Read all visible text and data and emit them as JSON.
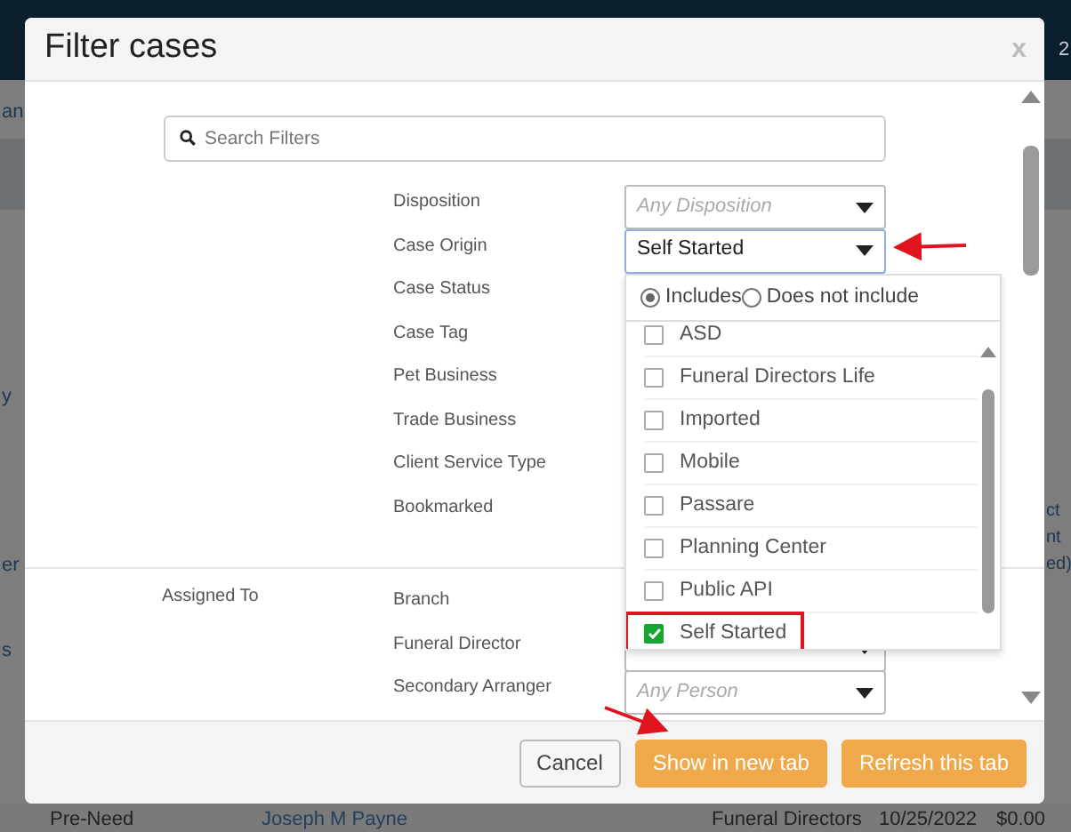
{
  "background": {
    "top_fragment": "2",
    "left_fragments": [
      "an",
      "y",
      "er",
      "s"
    ],
    "right_fragments": [
      "ct",
      "nt",
      "ed)"
    ],
    "bottom_row": [
      "Pre-Need",
      "Joseph M Payne",
      "Funeral Directors",
      "10/25/2022",
      "$0.00"
    ]
  },
  "dialog": {
    "title": "Filter cases",
    "close": "x",
    "search": {
      "placeholder": "Search Filters"
    },
    "filters": [
      {
        "label": "Disposition",
        "placeholder": "Any Disposition"
      },
      {
        "label": "Case Origin",
        "value": "Self Started",
        "focused": true
      },
      {
        "label": "Case Status"
      },
      {
        "label": "Case Tag"
      },
      {
        "label": "Pet Business"
      },
      {
        "label": "Trade Business"
      },
      {
        "label": "Client Service Type"
      },
      {
        "label": "Bookmarked"
      }
    ],
    "assigned": {
      "heading": "Assigned To",
      "filters": [
        {
          "label": "Branch"
        },
        {
          "label": "Funeral Director",
          "field": true
        },
        {
          "label": "Secondary Arranger",
          "placeholder": "Any Person"
        }
      ]
    },
    "dropdown": {
      "modes": [
        {
          "label": "Includes",
          "selected": true
        },
        {
          "label": "Does not include",
          "selected": false
        }
      ],
      "options": [
        {
          "label": "ASD",
          "checked": false,
          "highlighted": false
        },
        {
          "label": "Funeral Directors Life",
          "checked": false,
          "highlighted": false
        },
        {
          "label": "Imported",
          "checked": false,
          "highlighted": false
        },
        {
          "label": "Mobile",
          "checked": false,
          "highlighted": false
        },
        {
          "label": "Passare",
          "checked": false,
          "highlighted": false
        },
        {
          "label": "Planning Center",
          "checked": false,
          "highlighted": false
        },
        {
          "label": "Public API",
          "checked": false,
          "highlighted": false
        },
        {
          "label": "Self Started",
          "checked": true,
          "highlighted": true
        }
      ]
    },
    "buttons": [
      {
        "label": "Cancel",
        "kind": "secondary"
      },
      {
        "label": "Show in new tab",
        "kind": "primary"
      },
      {
        "label": "Refresh this tab",
        "kind": "primary"
      }
    ]
  }
}
